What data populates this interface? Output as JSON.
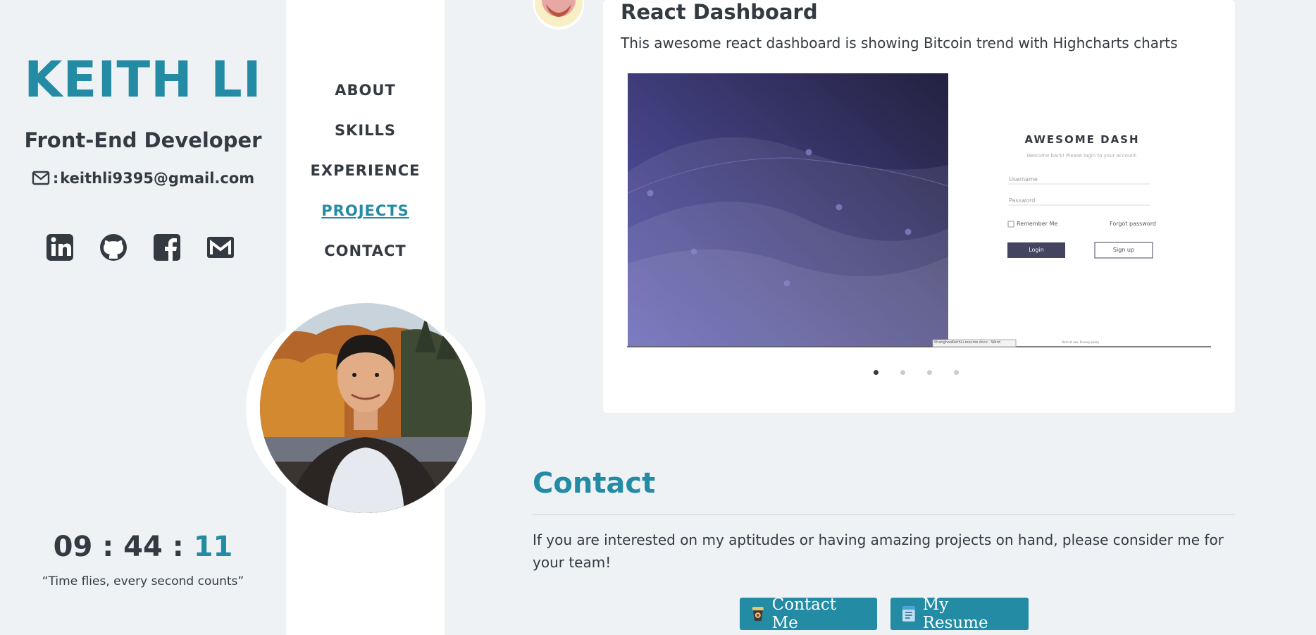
{
  "profile": {
    "name": "KEITH LI",
    "role": "Front-End Developer",
    "email_prefix": ":",
    "email": "keithli9395@gmail.com",
    "socials": [
      "linkedin-icon",
      "github-icon",
      "facebook-icon",
      "gmail-icon"
    ],
    "clock": {
      "hours": "09",
      "minutes": "44",
      "seconds": "11",
      "sep": ":"
    },
    "quote": "“Time flies, every second counts”"
  },
  "nav": {
    "items": [
      {
        "label": "ABOUT",
        "active": false
      },
      {
        "label": "SKILLS",
        "active": false
      },
      {
        "label": "EXPERIENCE",
        "active": false
      },
      {
        "label": "PROJECTS",
        "active": true
      },
      {
        "label": "CONTACT",
        "active": false
      }
    ]
  },
  "project": {
    "title": "React Dashboard",
    "description": "This awesome react dashboard is showing Bitcoin trend with Highcharts charts",
    "screenshot": {
      "brand": "AWESOME DASH",
      "welcome": "Welcome back! Please login to your account.",
      "username_placeholder": "Username",
      "password_placeholder": "Password",
      "remember": "Remember Me",
      "forgot": "Forgot password",
      "login": "Login",
      "signup": "Sign up",
      "taskbar": "ShanghaoKeithLi-resume.docx - Word",
      "footer": "Term of use. Privacy policy"
    },
    "carousel": {
      "slides": 4,
      "active": 0
    }
  },
  "contact": {
    "title": "Contact",
    "text": "If you are interested on my aptitudes or having amazing projects on hand, please consider me for your team!",
    "contact_button": "Contact Me",
    "resume_button": "My Resume"
  },
  "colors": {
    "accent": "#238ba4",
    "text": "#333a42",
    "background": "#eff2f5"
  }
}
